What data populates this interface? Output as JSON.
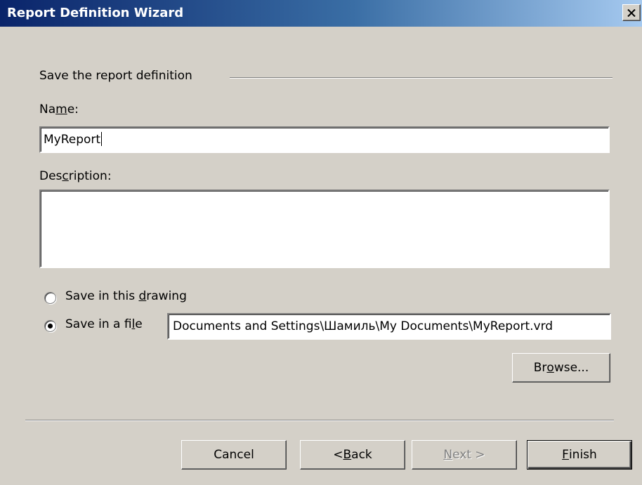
{
  "window": {
    "title": "Report Definition Wizard",
    "close_symbol": "×"
  },
  "group": {
    "title": "Save the report definition"
  },
  "name": {
    "label_pre": "Na",
    "label_mnemonic": "m",
    "label_post": "e:",
    "value": "MyReport"
  },
  "description": {
    "label_pre": "Des",
    "label_mnemonic": "c",
    "label_post": "ription:",
    "value": ""
  },
  "save_options": [
    {
      "label_pre": "Save in this ",
      "label_mnemonic": "d",
      "label_post": "rawing",
      "selected": false
    },
    {
      "label_pre": "Save in a fi",
      "label_mnemonic": "l",
      "label_post": "e",
      "selected": true
    }
  ],
  "file_path": "Documents and Settings\\Шамиль\\My Documents\\MyReport.vrd",
  "browse": {
    "label_pre": "Br",
    "label_mnemonic": "o",
    "label_post": "wse..."
  },
  "footer": {
    "cancel": "Cancel",
    "back_pre": "< ",
    "back_mnemonic": "B",
    "back_post": "ack",
    "next_mnemonic": "N",
    "next_post": "ext >",
    "finish_mnemonic": "F",
    "finish_post": "inish"
  },
  "icons": {
    "close": "close-icon",
    "radio_unselected": "radio-unselected-icon",
    "radio_selected": "radio-selected-icon"
  }
}
